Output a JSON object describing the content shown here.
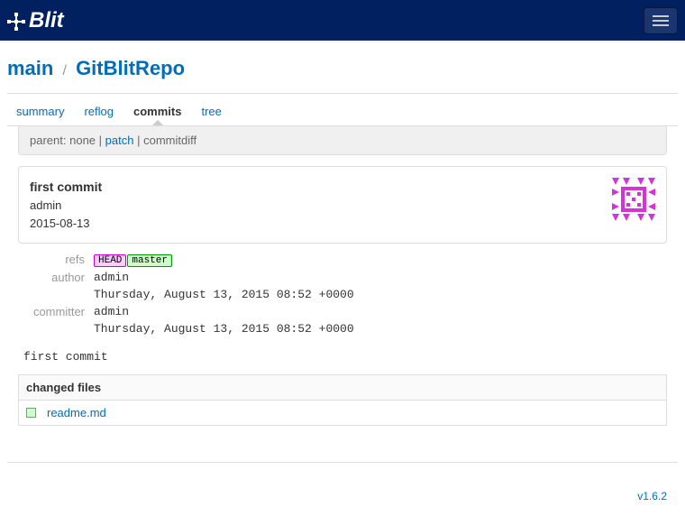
{
  "brand": "Blit",
  "breadcrumb": {
    "root": "main",
    "sep": "/",
    "repo": "GitBlitRepo"
  },
  "tabs": {
    "summary": "summary",
    "reflog": "reflog",
    "commits": "commits",
    "tree": "tree"
  },
  "parentbar": {
    "parent_label": "parent:",
    "parent_value": "none",
    "sep": " | ",
    "patch": "patch",
    "commitdiff": "commitdiff"
  },
  "commit": {
    "title": "first commit",
    "author_short": "admin",
    "date_short": "2015-08-13"
  },
  "details": {
    "refs_label": "refs",
    "ref_head": "HEAD",
    "ref_master": "master",
    "author_label": "author",
    "author_name": "admin",
    "author_date": "Thursday, August 13, 2015 08:52 +0000",
    "committer_label": "committer",
    "committer_name": "admin",
    "committer_date": "Thursday, August 13, 2015 08:52 +0000"
  },
  "commit_message": "first commit",
  "files_header": "changed files",
  "files": {
    "0": {
      "name": "readme.md"
    }
  },
  "version": "v1.6.2"
}
